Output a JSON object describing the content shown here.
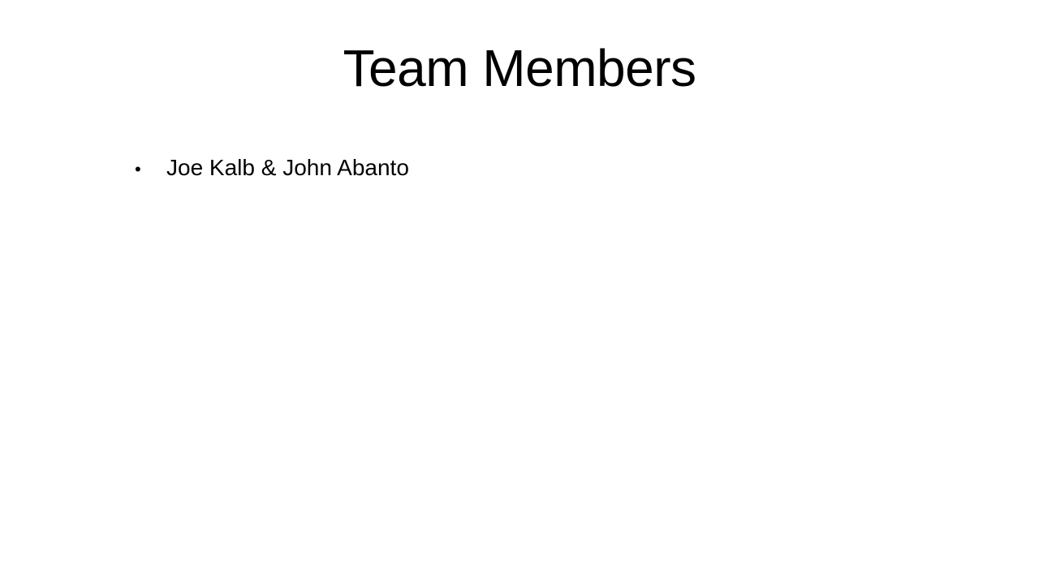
{
  "slide": {
    "title": "Team Members",
    "bullets": [
      {
        "marker": "•",
        "text": "Joe Kalb & John Abanto"
      }
    ]
  }
}
